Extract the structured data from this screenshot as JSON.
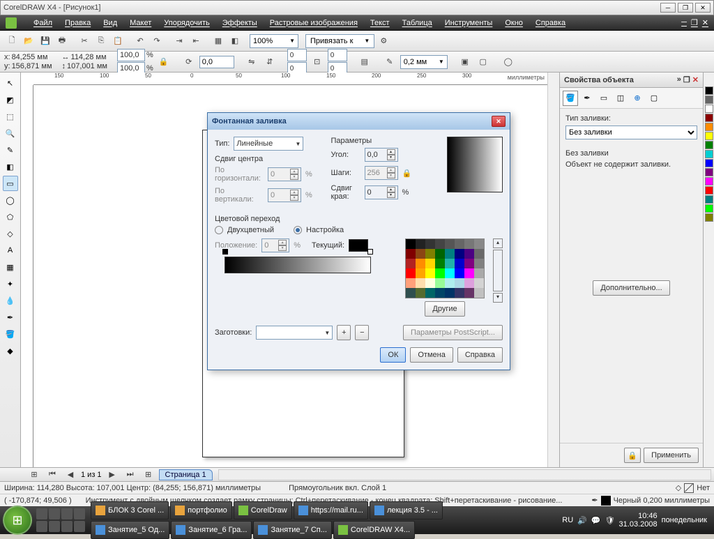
{
  "window": {
    "title": "CorelDRAW X4 - [Рисунок1]"
  },
  "menu": [
    "Файл",
    "Правка",
    "Вид",
    "Макет",
    "Упорядочить",
    "Эффекты",
    "Растровые изображения",
    "Текст",
    "Таблица",
    "Инструменты",
    "Окно",
    "Справка"
  ],
  "zoom": "100%",
  "snap_label": "Привязать к",
  "coords": {
    "x": "84,255 мм",
    "y": "156,871 мм",
    "w": "114,28 мм",
    "h": "107,001 мм"
  },
  "scale": {
    "x": "100,0",
    "y": "100,0"
  },
  "rotate": "0,0",
  "outline_width": "0,2 мм",
  "ruler_units": "миллиметры",
  "ruler_ticks_h": [
    "150",
    "100",
    "50",
    "0",
    "50",
    "100",
    "150",
    "200",
    "250",
    "300"
  ],
  "page_nav": {
    "label": "1 из 1",
    "tab": "Страница 1"
  },
  "status1": {
    "size": "Ширина: 114,280 Высота: 107,001 Центр: (84,255; 156,871) миллиметры",
    "layer": "Прямоугольник вкл. Слой 1"
  },
  "status2": {
    "coords": "( -170,874; 49,506 )",
    "hint": "Инструмент с двойным щелчком создает рамку страницы; Ctrl+перетаскивание - конец квадрата; Shift+перетаскивание - рисование...",
    "fill": "Нет",
    "outline": "Черный  0,200 миллиметры"
  },
  "panel": {
    "title": "Свойства объекта",
    "fill_type_label": "Тип заливки:",
    "fill_type": "Без заливки",
    "no_fill": "Без заливки",
    "no_fill_msg": "Объект не содержит заливки.",
    "more_btn": "Дополнительно...",
    "apply": "Применить"
  },
  "dialog": {
    "title": "Фонтанная заливка",
    "type_label": "Тип:",
    "type_value": "Линейные",
    "center_shift": "Сдвиг центра",
    "horiz": "По горизонтали:",
    "vert": "По вертикали:",
    "horiz_val": "0",
    "vert_val": "0",
    "params": "Параметры",
    "angle": "Угол:",
    "angle_val": "0,0",
    "steps": "Шаги:",
    "steps_val": "256",
    "edge": "Сдвиг края:",
    "edge_val": "0",
    "color_blend": "Цветовой переход",
    "two_color": "Двухцветный",
    "custom": "Настройка",
    "position": "Положение:",
    "position_val": "0",
    "current": "Текущий:",
    "other": "Другие",
    "presets": "Заготовки:",
    "postscript": "Параметры PostScript...",
    "ok": "ОК",
    "cancel": "Отмена",
    "help": "Справка"
  },
  "taskbar": {
    "items": [
      "БЛОК 3 Corel ...",
      "портфолио",
      "CorelDraw",
      "https://mail.ru...",
      "лекция 3.5 - ...",
      "Занятие_5 Од...",
      "Занятие_6 Гра...",
      "Занятие_7 Сп...",
      "CorelDRAW X4..."
    ],
    "lang": "RU",
    "time": "10:46",
    "date": "31.03.2008",
    "day": "понедельник"
  },
  "palette_sidebar": [
    "#000000",
    "#666666",
    "#ffffff",
    "#8b0000",
    "#ff8c00",
    "#ffff00",
    "#008000",
    "#00ced1",
    "#0000ff",
    "#800080",
    "#ff00ff",
    "#ff0000",
    "#008080",
    "#00ff00",
    "#808000"
  ],
  "dialog_palette": [
    "#000",
    "#222",
    "#333",
    "#444",
    "#555",
    "#666",
    "#777",
    "#888",
    "#800000",
    "#8b4513",
    "#808000",
    "#006400",
    "#008080",
    "#000080",
    "#4b0082",
    "#696969",
    "#b22222",
    "#ff8c00",
    "#ffd700",
    "#008000",
    "#20b2aa",
    "#0000cd",
    "#800080",
    "#808080",
    "#ff0000",
    "#ffa500",
    "#ffff00",
    "#00ff00",
    "#00ffff",
    "#0000ff",
    "#ff00ff",
    "#a9a9a9",
    "#ffa07a",
    "#ffdead",
    "#ffffe0",
    "#98fb98",
    "#afeeee",
    "#add8e6",
    "#dda0dd",
    "#d3d3d3",
    "#2f4f4f",
    "#556b2f",
    "#006666",
    "#004466",
    "#003366",
    "#333366",
    "#663366",
    "#c0c0c0"
  ]
}
